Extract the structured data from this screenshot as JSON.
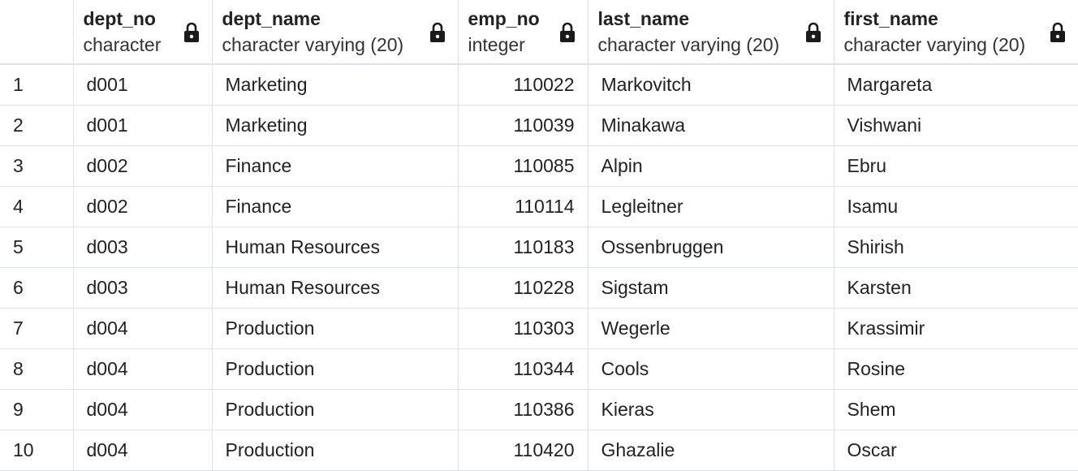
{
  "columns": [
    {
      "name": "dept_no",
      "type": "character"
    },
    {
      "name": "dept_name",
      "type": "character varying (20)"
    },
    {
      "name": "emp_no",
      "type": "integer"
    },
    {
      "name": "last_name",
      "type": "character varying (20)"
    },
    {
      "name": "first_name",
      "type": "character varying (20)"
    }
  ],
  "rows": [
    {
      "idx": "1",
      "dept_no": "d001",
      "dept_name": "Marketing",
      "emp_no": "110022",
      "last_name": "Markovitch",
      "first_name": "Margareta"
    },
    {
      "idx": "2",
      "dept_no": "d001",
      "dept_name": "Marketing",
      "emp_no": "110039",
      "last_name": "Minakawa",
      "first_name": "Vishwani"
    },
    {
      "idx": "3",
      "dept_no": "d002",
      "dept_name": "Finance",
      "emp_no": "110085",
      "last_name": "Alpin",
      "first_name": "Ebru"
    },
    {
      "idx": "4",
      "dept_no": "d002",
      "dept_name": "Finance",
      "emp_no": "110114",
      "last_name": "Legleitner",
      "first_name": "Isamu"
    },
    {
      "idx": "5",
      "dept_no": "d003",
      "dept_name": "Human Resources",
      "emp_no": "110183",
      "last_name": "Ossenbruggen",
      "first_name": "Shirish"
    },
    {
      "idx": "6",
      "dept_no": "d003",
      "dept_name": "Human Resources",
      "emp_no": "110228",
      "last_name": "Sigstam",
      "first_name": "Karsten"
    },
    {
      "idx": "7",
      "dept_no": "d004",
      "dept_name": "Production",
      "emp_no": "110303",
      "last_name": "Wegerle",
      "first_name": "Krassimir"
    },
    {
      "idx": "8",
      "dept_no": "d004",
      "dept_name": "Production",
      "emp_no": "110344",
      "last_name": "Cools",
      "first_name": "Rosine"
    },
    {
      "idx": "9",
      "dept_no": "d004",
      "dept_name": "Production",
      "emp_no": "110386",
      "last_name": "Kieras",
      "first_name": "Shem"
    },
    {
      "idx": "10",
      "dept_no": "d004",
      "dept_name": "Production",
      "emp_no": "110420",
      "last_name": "Ghazalie",
      "first_name": "Oscar"
    }
  ],
  "icons": {
    "column_lock": "lock-icon"
  }
}
